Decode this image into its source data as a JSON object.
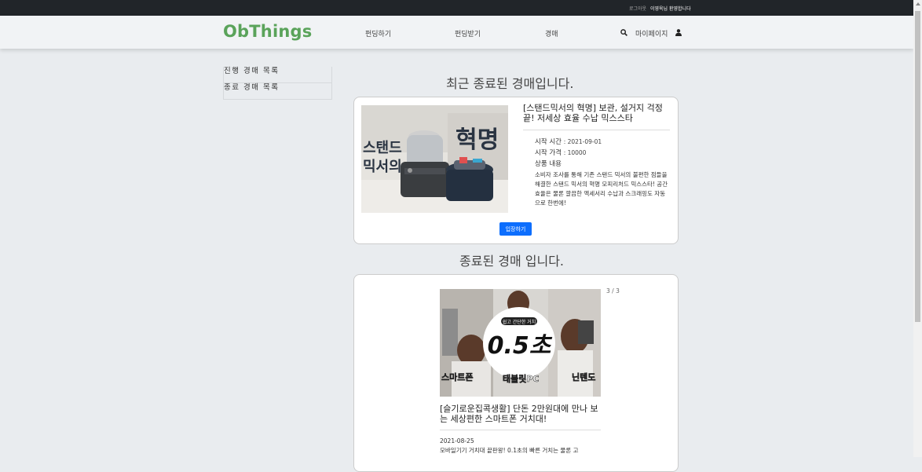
{
  "topbar": {
    "logout": "로그아웃",
    "welcome": "이영욱님 환영합니다"
  },
  "nav": {
    "brand": "ObThings",
    "links": [
      "펀딩하기",
      "펀딩받기",
      "경매"
    ],
    "mypage": "마이페이지"
  },
  "sidebar": {
    "items": [
      "진행 경매 목록",
      "종료 경매 목록"
    ]
  },
  "recent": {
    "heading": "최근 종료된 경매입니다.",
    "title": "[스탠드믹서의 혁명] 보관, 설거지 걱정 끝! 저세상 효율 수납 믹스스타",
    "start_time_label": "시작 시간",
    "start_time": ": 2021-09-01",
    "start_price_label": "시작 가격",
    "start_price": ": 10000",
    "content_label": "상품 내용",
    "description": "소비자 조사를 통해 기존 스탠드 믹서의 불편한 점들을 해결한 스탠드 믹서의 혁명 모피리처드 믹스스타! 공간효율은 물론 깔끔한 액세서리 수납과 스크래핑도 자동으로 한번에!",
    "image_text": "스탠드 믹서의 혁명",
    "enter_button": "입장하기"
  },
  "ended": {
    "heading": "종료된 경매 입니다.",
    "counter": "3 / 3",
    "image_badge": "쉽고 간단한 거치",
    "image_big": "0.5초",
    "image_labels": [
      "스마트폰",
      "태블릿PC",
      "닌텐도"
    ],
    "title": "[슬기로운집콕생활] 단돈 2만원대에 만나 보는 세상편한 스마트폰 거치대!",
    "date": "2021-08-25",
    "description": "모바일기기 거치대 끝판왕! 0.1초의 빠른 거치는 물론 고"
  },
  "colors": {
    "brand": "#5aa35a",
    "button": "#0d6efd",
    "topbar": "#212529"
  }
}
